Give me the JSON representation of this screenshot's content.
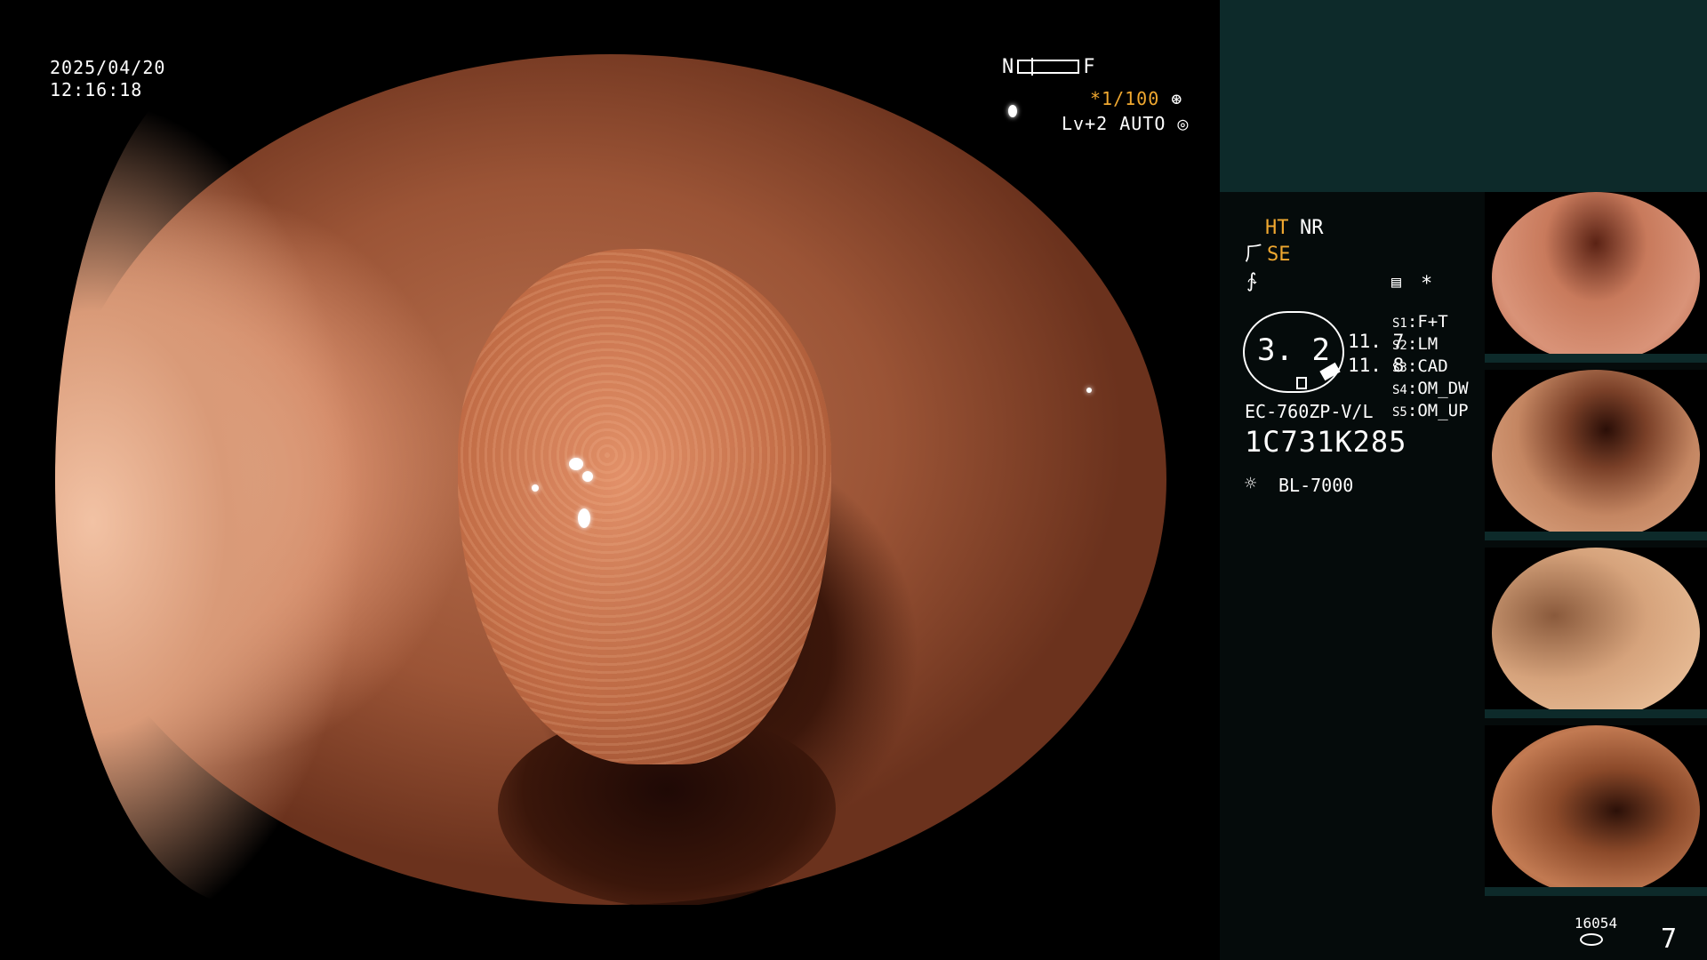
{
  "overlay": {
    "date": "2025/04/20",
    "time": "12:16:18",
    "nf_left": "N",
    "nf_right": "F",
    "shutter": "*1/100",
    "level": "Lv+2 AUTO"
  },
  "panel": {
    "ht": "HT",
    "nr": "NR",
    "se": "SE",
    "star": "*",
    "zoom": "3. 2",
    "zoom_a": "11. 7",
    "zoom_b": "11. 8",
    "presets": [
      {
        "key": "S1",
        "value": "F+T"
      },
      {
        "key": "S2",
        "value": "LM"
      },
      {
        "key": "S3",
        "value": "CAD"
      },
      {
        "key": "S4",
        "value": "OM_DW"
      },
      {
        "key": "S5",
        "value": "OM_UP"
      }
    ],
    "scope_model": "EC-760ZP-V/L",
    "scope_serial": "1C731K285",
    "light_source": "BL-7000",
    "storage_count": "16054",
    "image_count": "7"
  },
  "colors": {
    "accent_orange": "#f0a830",
    "panel_top": "#0d2a2a",
    "panel_bg": "#050b0b"
  },
  "icons": [
    "aperture-icon",
    "iris-icon",
    "menu-icon",
    "light-source-icon",
    "storage-icon",
    "structure-enhance-icon"
  ]
}
